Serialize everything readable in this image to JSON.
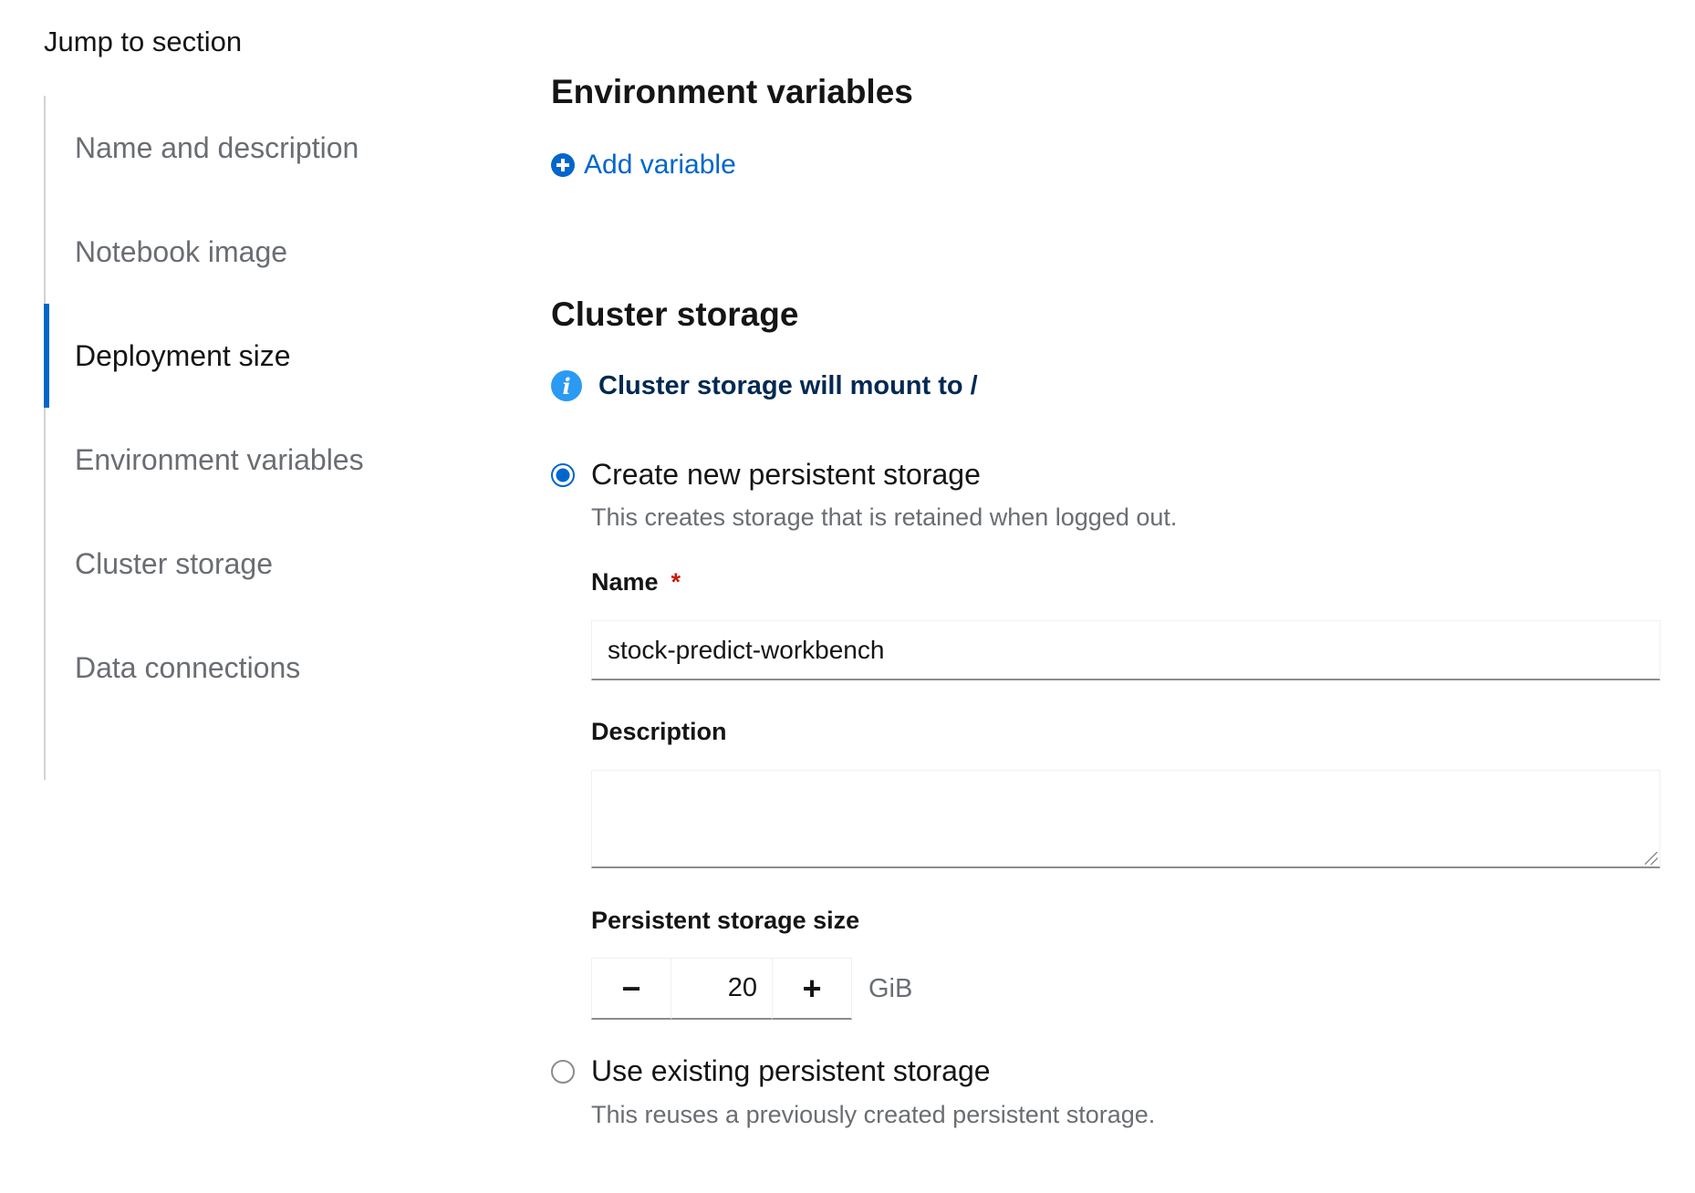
{
  "jump": {
    "title": "Jump to section",
    "items": [
      {
        "label": "Name and description"
      },
      {
        "label": "Notebook image"
      },
      {
        "label": "Deployment size"
      },
      {
        "label": "Environment variables"
      },
      {
        "label": "Cluster storage"
      },
      {
        "label": "Data connections"
      }
    ],
    "active_index": 2
  },
  "env": {
    "title": "Environment variables",
    "add_label": "Add variable"
  },
  "storage": {
    "title": "Cluster storage",
    "info": "Cluster storage will mount to /",
    "create": {
      "label": "Create new persistent storage",
      "desc": "This creates storage that is retained when logged out.",
      "checked": true
    },
    "name": {
      "label": "Name",
      "required_mark": "*",
      "value": "stock-predict-workbench"
    },
    "description": {
      "label": "Description",
      "value": ""
    },
    "size": {
      "label": "Persistent storage size",
      "minus": "−",
      "plus": "+",
      "value": "20",
      "unit": "GiB"
    },
    "existing": {
      "label": "Use existing persistent storage",
      "desc": "This reuses a previously created persistent storage.",
      "checked": false
    }
  },
  "colors": {
    "accent": "#0066cc",
    "info": "#2b9af3",
    "required": "#c9190b"
  }
}
